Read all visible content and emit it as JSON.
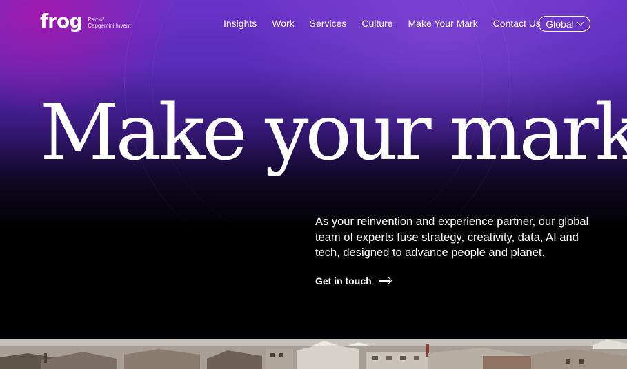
{
  "brand": {
    "logo_word": "frog",
    "logo_sub_line1": "Part of",
    "logo_sub_line2": "Capgemini Invent"
  },
  "nav": {
    "items": [
      {
        "label": "Insights"
      },
      {
        "label": "Work"
      },
      {
        "label": "Services"
      },
      {
        "label": "Culture"
      },
      {
        "label": "Make Your Mark"
      },
      {
        "label": "Contact Us"
      }
    ],
    "global_label": "Global"
  },
  "hero": {
    "headline": "Make your mark",
    "description": "As your reinvention and experience partner, our global team of experts fuse strategy, creativity, data, AI and tech, designed to advance people and planet.",
    "cta_label": "Get in touch"
  },
  "colors": {
    "hero_purple": "#6a33c8",
    "hero_magenta": "#aa14aa",
    "background": "#000000",
    "text": "#ffffff"
  },
  "icons": {
    "global_chevron": "chevron-down-icon",
    "cta_arrow": "arrow-right-icon"
  }
}
